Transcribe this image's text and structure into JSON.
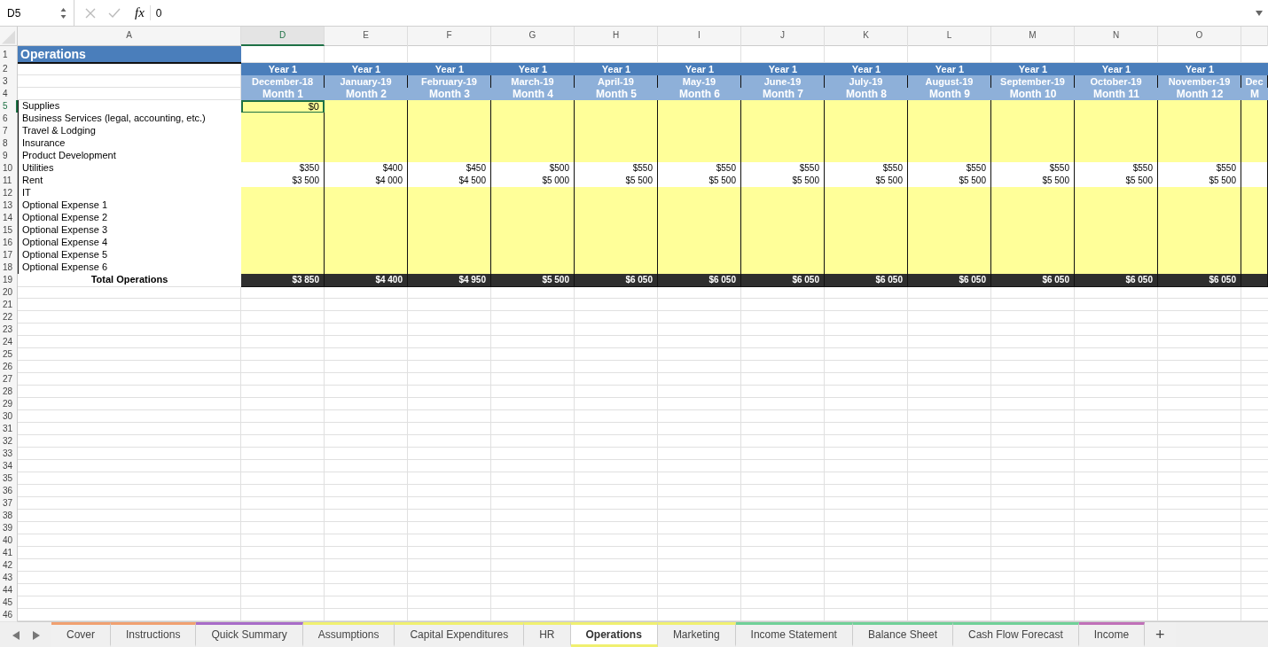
{
  "formula_bar": {
    "name_box": "D5",
    "fx": "fx",
    "value": "0"
  },
  "columns": [
    {
      "letter": "A",
      "selected": false
    },
    {
      "letter": "D",
      "selected": true
    },
    {
      "letter": "E",
      "selected": false
    },
    {
      "letter": "F",
      "selected": false
    },
    {
      "letter": "G",
      "selected": false
    },
    {
      "letter": "H",
      "selected": false
    },
    {
      "letter": "I",
      "selected": false
    },
    {
      "letter": "J",
      "selected": false
    },
    {
      "letter": "K",
      "selected": false
    },
    {
      "letter": "L",
      "selected": false
    },
    {
      "letter": "M",
      "selected": false
    },
    {
      "letter": "N",
      "selected": false
    },
    {
      "letter": "O",
      "selected": false
    }
  ],
  "title_row": {
    "number": "1",
    "title": "Operations",
    "selected": false
  },
  "header_rows": [
    {
      "number": "2",
      "kind": "year",
      "selected": false,
      "cells": [
        "Year 1",
        "Year 1",
        "Year 1",
        "Year 1",
        "Year 1",
        "Year 1",
        "Year 1",
        "Year 1",
        "Year 1",
        "Year 1",
        "Year 1",
        "Year 1"
      ]
    },
    {
      "number": "3",
      "kind": "date",
      "selected": false,
      "cells": [
        "December-18",
        "January-19",
        "February-19",
        "March-19",
        "April-19",
        "May-19",
        "June-19",
        "July-19",
        "August-19",
        "September-19",
        "October-19",
        "November-19",
        "Dec"
      ]
    },
    {
      "number": "4",
      "kind": "month",
      "selected": false,
      "cells": [
        "Month 1",
        "Month 2",
        "Month 3",
        "Month 4",
        "Month 5",
        "Month 6",
        "Month 7",
        "Month 8",
        "Month 9",
        "Month 10",
        "Month 11",
        "Month 12",
        "M"
      ]
    }
  ],
  "rows": [
    {
      "number": "5",
      "label": "Supplies",
      "kind": "input",
      "selected": true,
      "cells": [
        "$0"
      ]
    },
    {
      "number": "6",
      "label": "Business Services (legal, accounting, etc.)",
      "kind": "input",
      "selected": false,
      "cells": []
    },
    {
      "number": "7",
      "label": "Travel & Lodging",
      "kind": "input",
      "selected": false,
      "cells": []
    },
    {
      "number": "8",
      "label": "Insurance",
      "kind": "input",
      "selected": false,
      "cells": []
    },
    {
      "number": "9",
      "label": "Product Development",
      "kind": "input",
      "selected": false,
      "cells": []
    },
    {
      "number": "10",
      "label": "Utilities",
      "kind": "value",
      "selected": false,
      "cells": [
        "$350",
        "$400",
        "$450",
        "$500",
        "$550",
        "$550",
        "$550",
        "$550",
        "$550",
        "$550",
        "$550",
        "$550"
      ]
    },
    {
      "number": "11",
      "label": "Rent",
      "kind": "value",
      "selected": false,
      "cells": [
        "$3 500",
        "$4 000",
        "$4 500",
        "$5 000",
        "$5 500",
        "$5 500",
        "$5 500",
        "$5 500",
        "$5 500",
        "$5 500",
        "$5 500",
        "$5 500"
      ]
    },
    {
      "number": "12",
      "label": "IT",
      "kind": "input",
      "selected": false,
      "cells": []
    },
    {
      "number": "13",
      "label": "Optional Expense 1",
      "kind": "input",
      "selected": false,
      "cells": []
    },
    {
      "number": "14",
      "label": "Optional Expense 2",
      "kind": "input",
      "selected": false,
      "cells": []
    },
    {
      "number": "15",
      "label": "Optional Expense 3",
      "kind": "input",
      "selected": false,
      "cells": []
    },
    {
      "number": "16",
      "label": "Optional Expense 4",
      "kind": "input",
      "selected": false,
      "cells": []
    },
    {
      "number": "17",
      "label": "Optional Expense 5",
      "kind": "input",
      "selected": false,
      "cells": []
    },
    {
      "number": "18",
      "label": "Optional Expense 6",
      "kind": "input",
      "selected": false,
      "cells": []
    },
    {
      "number": "19",
      "label": "Total Operations",
      "kind": "total",
      "selected": false,
      "cells": [
        "$3 850",
        "$4 400",
        "$4 950",
        "$5 500",
        "$6 050",
        "$6 050",
        "$6 050",
        "$6 050",
        "$6 050",
        "$6 050",
        "$6 050",
        "$6 050"
      ]
    }
  ],
  "empty_rows": [
    "20",
    "21",
    "22",
    "23",
    "24",
    "25",
    "26",
    "27",
    "28",
    "29",
    "30",
    "31",
    "32",
    "33",
    "34",
    "35",
    "36",
    "37",
    "38",
    "39",
    "40",
    "41",
    "42",
    "43",
    "44",
    "45",
    "46"
  ],
  "sheet_tabs": [
    {
      "label": "Cover",
      "color": "#f0a070",
      "selected": false
    },
    {
      "label": "Instructions",
      "color": "#f0a070",
      "selected": false
    },
    {
      "label": "Quick Summary",
      "color": "#a86cc8",
      "selected": false
    },
    {
      "label": "Assumptions",
      "color": "#f0f070",
      "selected": false
    },
    {
      "label": "Capital Expenditures",
      "color": "#f0f070",
      "selected": false
    },
    {
      "label": "HR",
      "color": "#f0f070",
      "selected": false
    },
    {
      "label": "Operations",
      "color": "#f0f070",
      "selected": true
    },
    {
      "label": "Marketing",
      "color": "#f0f070",
      "selected": false
    },
    {
      "label": "Income Statement",
      "color": "#70d098",
      "selected": false
    },
    {
      "label": "Balance Sheet",
      "color": "#70d098",
      "selected": false
    },
    {
      "label": "Cash Flow Forecast",
      "color": "#70d098",
      "selected": false
    },
    {
      "label": "Income",
      "color": "#c070b8",
      "selected": false
    }
  ],
  "add_sheet": "+"
}
